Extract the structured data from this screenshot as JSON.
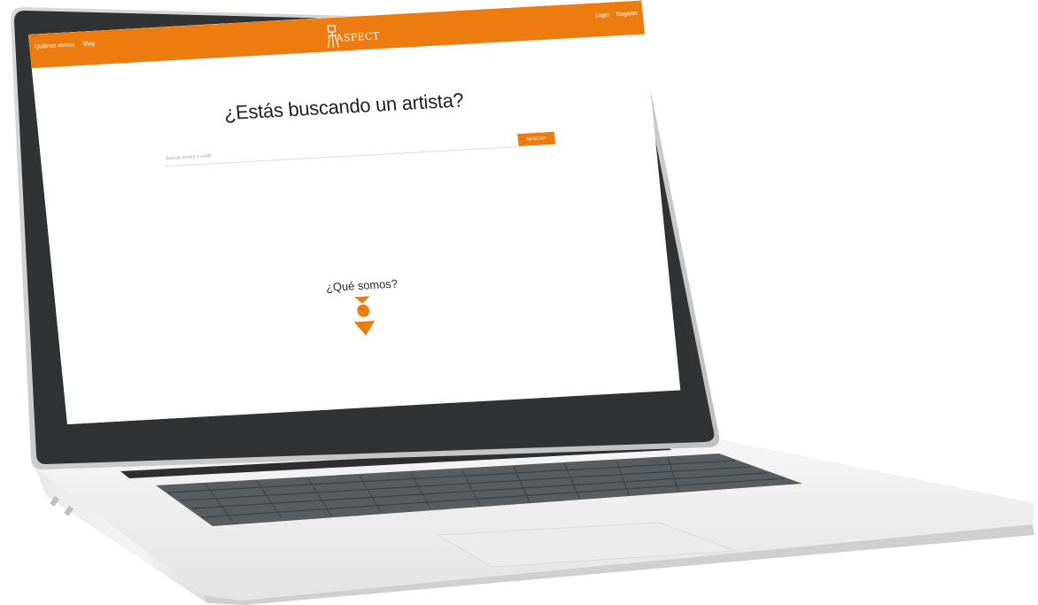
{
  "header": {
    "nav_left": [
      "Quiénes somos",
      "Blog"
    ],
    "logo_text": "ASPECT",
    "nav_right": [
      "Login",
      "Register"
    ]
  },
  "hero": {
    "title": "¿Estás buscando un artista?"
  },
  "search": {
    "placeholder": "Buscar artista o estilo",
    "button_label": "BUSCAR"
  },
  "about": {
    "title": "¿Qué somos?"
  },
  "colors": {
    "accent": "#ec7c10",
    "background": "#ffffff",
    "text": "#1f1f1f"
  },
  "icons": {
    "logo": "easel-logo-icon",
    "scroll": "chevron-down-icon"
  }
}
